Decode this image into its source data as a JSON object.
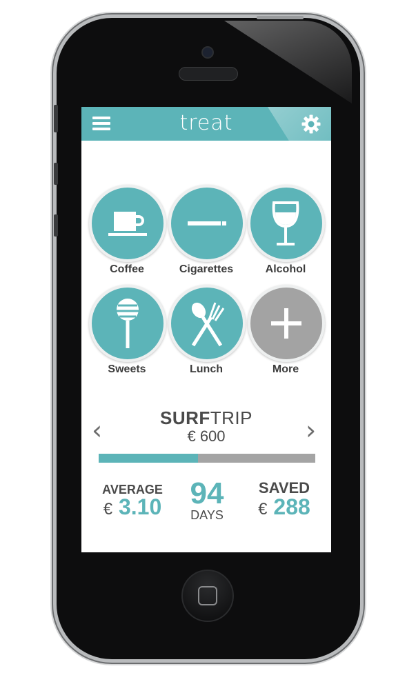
{
  "app": {
    "title": "treat"
  },
  "categories": [
    {
      "label": "Coffee",
      "icon": "coffee-cup-icon"
    },
    {
      "label": "Cigarettes",
      "icon": "cigarette-icon"
    },
    {
      "label": "Alcohol",
      "icon": "wine-glass-icon"
    },
    {
      "label": "Sweets",
      "icon": "lollipop-icon"
    },
    {
      "label": "Lunch",
      "icon": "spoon-fork-icon"
    },
    {
      "label": "More",
      "icon": "plus-icon"
    }
  ],
  "goal": {
    "name_bold": "SURF",
    "name_rest": "TRIP",
    "amount": "€ 600",
    "progress": 0.46,
    "prev": "‹",
    "next": "›"
  },
  "stats": {
    "average_label": "AVERAGE",
    "average_currency": "€",
    "average_value": "3.10",
    "days_value": "94",
    "days_label": "DAYS",
    "saved_label": "SAVED",
    "saved_currency": "€",
    "saved_value": "288"
  },
  "colors": {
    "accent": "#5cb4b8",
    "more": "#a3a3a3",
    "text": "#4a4a4a"
  }
}
